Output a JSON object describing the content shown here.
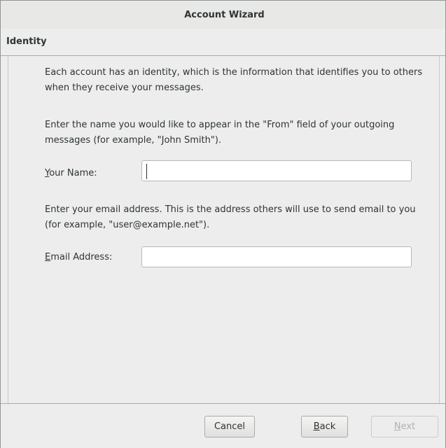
{
  "window": {
    "title": "Account Wizard"
  },
  "page": {
    "title": "Identity"
  },
  "content": {
    "intro_text": "Each account has an identity, which is the information that identifies you to others when they receive your messages.",
    "name_instructions": "Enter the name you would like to appear in the \"From\" field of your outgoing messages (for example, \"John Smith\").",
    "name_label_mnemonic": "Y",
    "name_label_rest": "our Name:",
    "name_value": "",
    "email_instructions": "Enter your email address. This is the address others will use to send email to you (for example, \"user@example.net\").",
    "email_label_mnemonic": "E",
    "email_label_rest": "mail Address:",
    "email_value": ""
  },
  "buttons": {
    "cancel_label": "Cancel",
    "back_label_mnemonic": "B",
    "back_label_rest": "ack",
    "next_label_mnemonic": "N",
    "next_label_rest": "ext",
    "next_enabled": false
  }
}
